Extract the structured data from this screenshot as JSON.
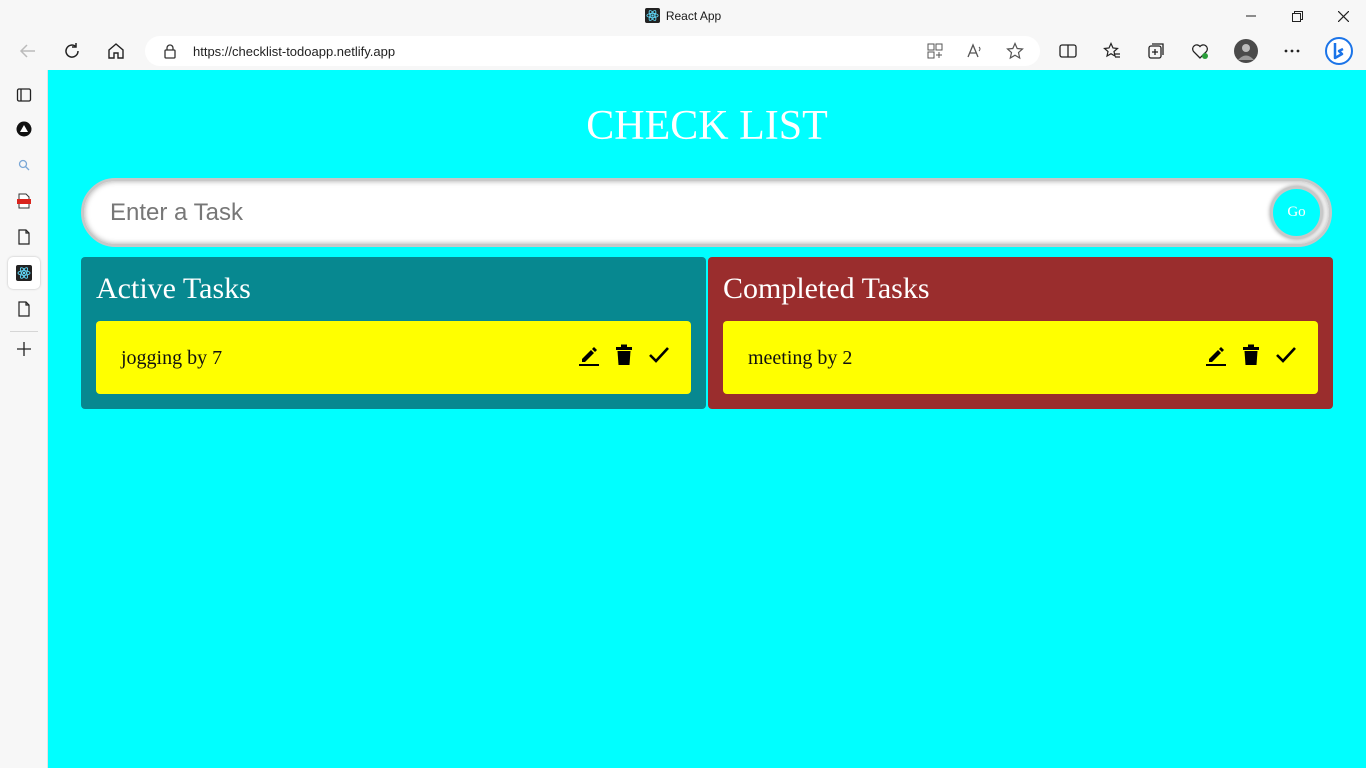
{
  "browser": {
    "tab_title": "React App",
    "url_host": "https://checklist-todoapp.netlify.app",
    "colors": {
      "chrome": "#f7f7f7"
    }
  },
  "app": {
    "title": "CHECK LIST",
    "input": {
      "placeholder": "Enter a Task",
      "value": ""
    },
    "go_label": "Go",
    "active": {
      "heading": "Active Tasks",
      "tasks": [
        {
          "text": "jogging by 7"
        }
      ]
    },
    "completed": {
      "heading": "Completed Tasks",
      "tasks": [
        {
          "text": "meeting by 2"
        }
      ]
    },
    "colors": {
      "background": "#00ffff",
      "active_panel": "#078890",
      "completed_panel": "#9a2d2d",
      "task_card": "#ffff00"
    },
    "icons": [
      "edit-icon",
      "delete-icon",
      "check-icon"
    ]
  }
}
